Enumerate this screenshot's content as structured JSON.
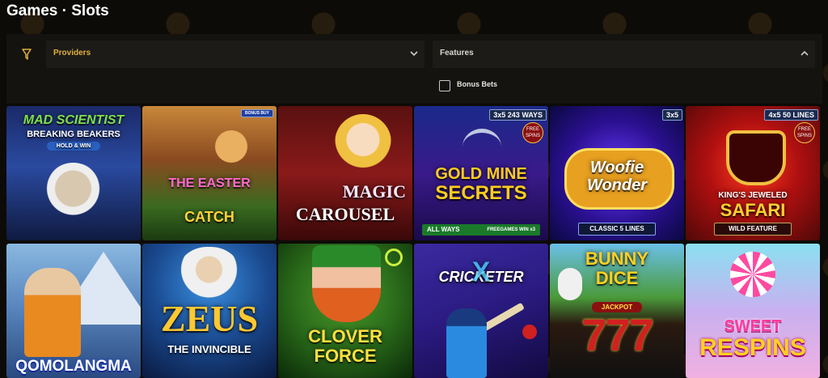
{
  "header": {
    "title": "Games · Slots"
  },
  "filters": {
    "providers_label": "Providers",
    "features_label": "Features",
    "features_options": [
      {
        "label": "Bonus Bets",
        "checked": false
      }
    ]
  },
  "games": [
    {
      "name_line1": "MAD SCIENTIST",
      "name_line2": "BREAKING BEAKERS",
      "tag": "HOLD & WIN"
    },
    {
      "name_line1": "THE EASTER",
      "name_line2": "CATCH",
      "badge": "BONUS BUY"
    },
    {
      "name_line1": "MAGIC",
      "name_line2": "CAROUSEL"
    },
    {
      "name_line1": "GOLD MINE",
      "name_line2": "SECRETS",
      "badge": "3x5 243 WAYS",
      "strip_left": "ALL WAYS",
      "strip_right": "FREEGAMES WIN x3",
      "free": "FREE SPINS"
    },
    {
      "name_line1": "Woofie",
      "name_line2": "Wonder",
      "badge": "3x5",
      "strip": "CLASSIC 5 LINES"
    },
    {
      "name_line1": "KING'S JEWELED",
      "name_line2": "SAFARI",
      "badge": "4x5 50 LINES",
      "strip": "WILD FEATURE",
      "free": "FREE SPINS"
    },
    {
      "name_line1": "QOMOLANGMA"
    },
    {
      "name_line1": "ZEUS",
      "name_line2": "THE INVINCIBLE"
    },
    {
      "name_line1": "CLOVER",
      "name_line2": "FORCE"
    },
    {
      "name_line1": "CRICKETER",
      "name_line2": "X"
    },
    {
      "name_line1": "BUNNY",
      "name_line2": "DICE",
      "jackpot": "JACKPOT"
    },
    {
      "name_line1": "SWEET",
      "name_line2": "RESPINS"
    }
  ]
}
